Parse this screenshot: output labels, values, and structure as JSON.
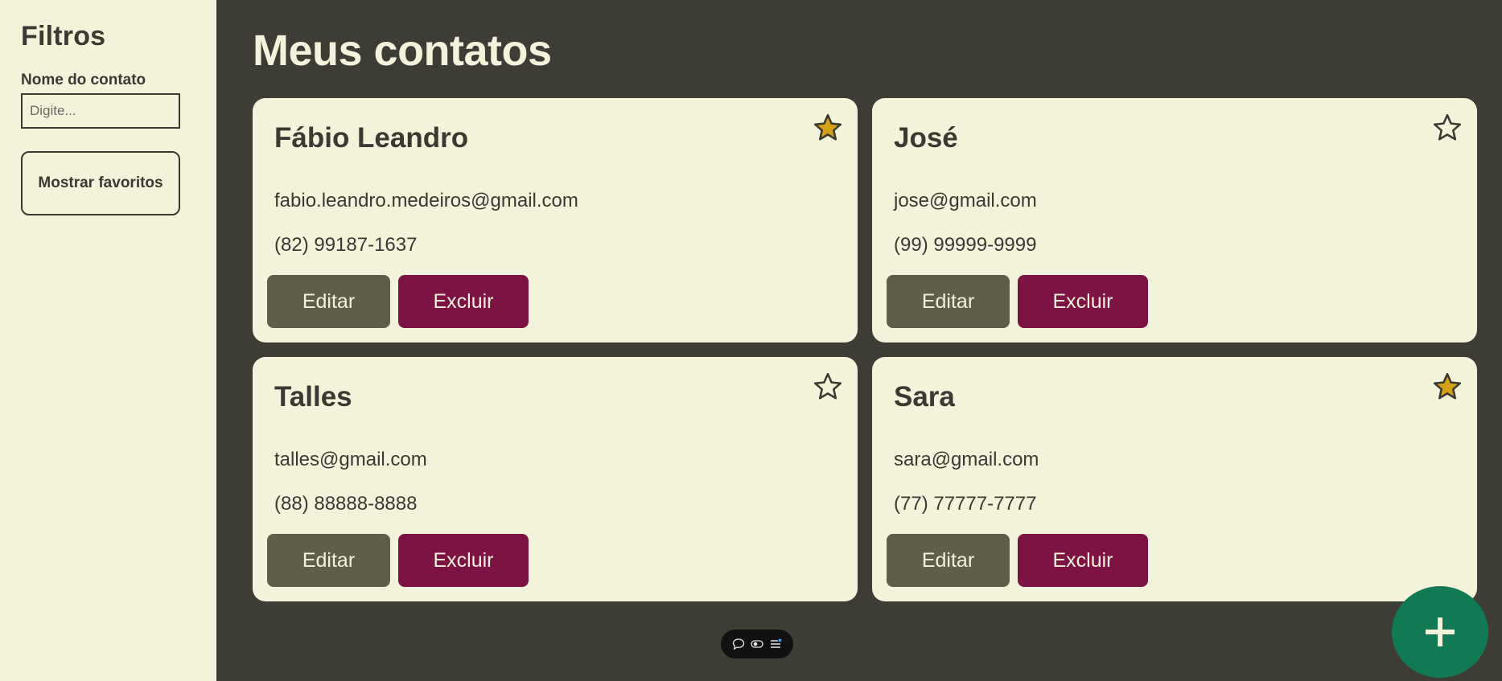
{
  "sidebar": {
    "title": "Filtros",
    "filter_label": "Nome do contato",
    "filter_placeholder": "Digite...",
    "filter_value": "",
    "favorites_button": "Mostrar favoritos"
  },
  "main": {
    "title": "Meus contatos",
    "contacts": [
      {
        "name": "Fábio Leandro",
        "email": "fabio.leandro.medeiros@gmail.com",
        "phone": "(82) 99187-1637",
        "favorite": true
      },
      {
        "name": "José",
        "email": "jose@gmail.com",
        "phone": "(99) 99999-9999",
        "favorite": false
      },
      {
        "name": "Talles",
        "email": "talles@gmail.com",
        "phone": "(88) 88888-8888",
        "favorite": false
      },
      {
        "name": "Sara",
        "email": "sara@gmail.com",
        "phone": "(77) 77777-7777",
        "favorite": true
      }
    ],
    "edit_label": "Editar",
    "delete_label": "Excluir"
  },
  "fab": {
    "label": "+",
    "icon": "plus-icon"
  },
  "toolbar": {
    "icons": [
      "chat-icon",
      "toggle-icon",
      "menu-icon"
    ]
  },
  "colors": {
    "background": "#3d3d35",
    "surface": "#f3f2da",
    "edit_button": "#5f5e4a",
    "delete_button": "#7d1244",
    "favorite_star": "#d4a017",
    "fab": "#117a55"
  }
}
